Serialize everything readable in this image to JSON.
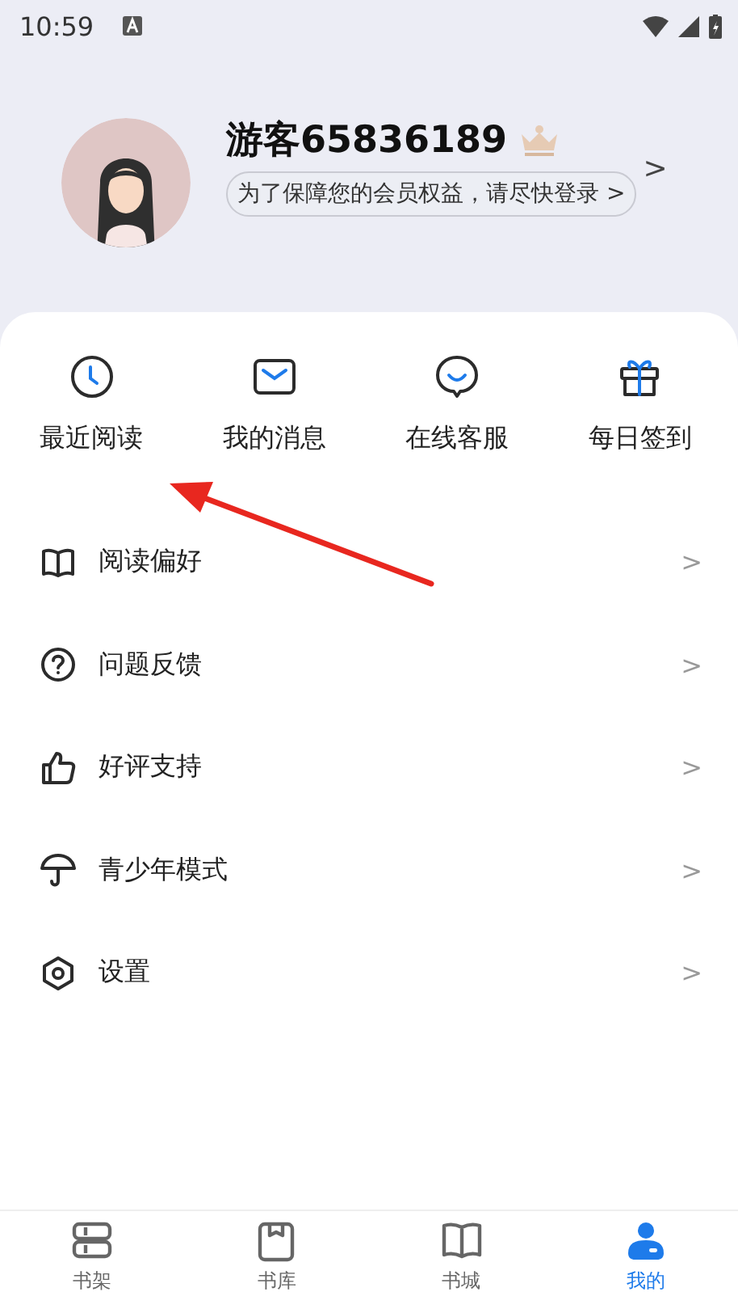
{
  "status_bar": {
    "time": "10:59"
  },
  "profile": {
    "name": "游客65836189",
    "login_hint": "为了保障您的会员权益，请尽快登录 >",
    "chevron": ">"
  },
  "shortcuts": [
    {
      "label": "最近阅读",
      "kind": "clock"
    },
    {
      "label": "我的消息",
      "kind": "mail"
    },
    {
      "label": "在线客服",
      "kind": "chat"
    },
    {
      "label": "每日签到",
      "kind": "gift"
    }
  ],
  "menu": [
    {
      "label": "阅读偏好",
      "kind": "book",
      "chevron": ">"
    },
    {
      "label": "问题反馈",
      "kind": "question",
      "chevron": ">"
    },
    {
      "label": "好评支持",
      "kind": "thumb",
      "chevron": ">"
    },
    {
      "label": "青少年模式",
      "kind": "umbrella",
      "chevron": ">"
    },
    {
      "label": "设置",
      "kind": "settings",
      "chevron": ">"
    }
  ],
  "tab_bar": [
    {
      "label": "书架",
      "kind": "shelf",
      "selected": false
    },
    {
      "label": "书库",
      "kind": "library",
      "selected": false
    },
    {
      "label": "书城",
      "kind": "store",
      "selected": false
    },
    {
      "label": "我的",
      "kind": "user",
      "selected": true
    }
  ]
}
